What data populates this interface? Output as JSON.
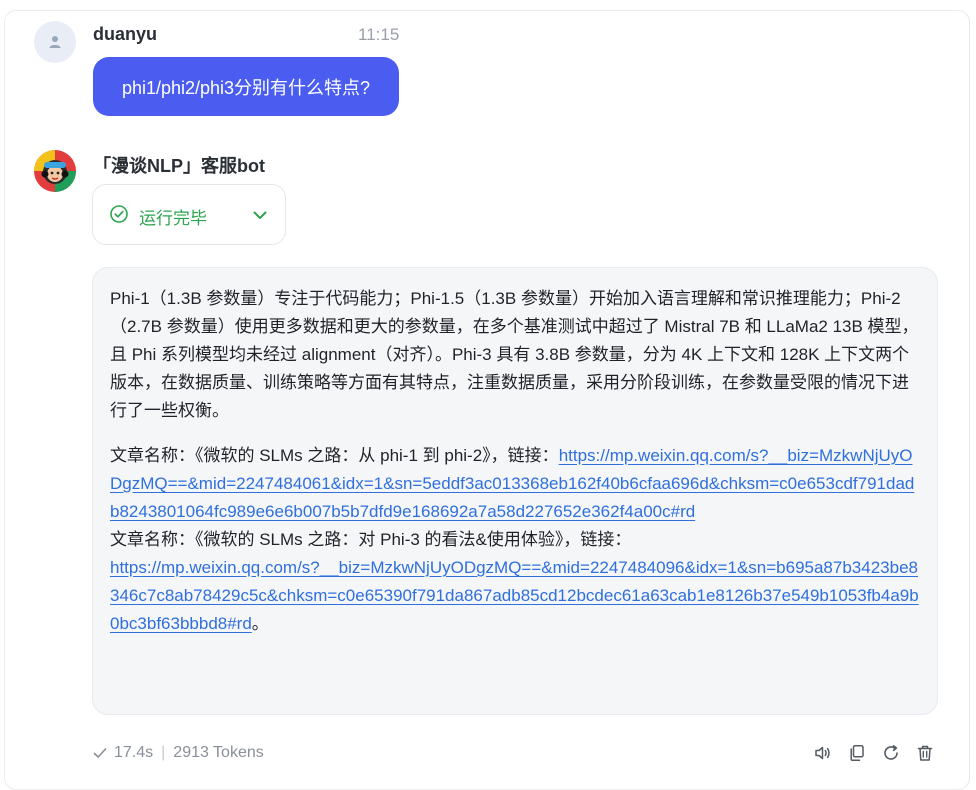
{
  "user_message": {
    "author": "duanyu",
    "time": "11:15",
    "text": "phi1/phi2/phi3分别有什么特点?"
  },
  "bot_message": {
    "author": "「漫谈NLP」客服bot",
    "status": "运行完毕",
    "paragraph": "Phi-1（1.3B 参数量）专注于代码能力；Phi-1.5（1.3B 参数量）开始加入语言理解和常识推理能力；Phi-2（2.7B 参数量）使用更多数据和更大的参数量，在多个基准测试中超过了 Mistral 7B 和 LLaMa2 13B 模型，且 Phi 系列模型均未经过 alignment（对齐）。Phi-3 具有 3.8B 参数量，分为 4K 上下文和 128K 上下文两个版本，在数据质量、训练策略等方面有其特点，注重数据质量，采用分阶段训练，在参数量受限的情况下进行了一些权衡。",
    "ref1_prefix": "文章名称：《微软的 SLMs 之路：从 phi-1 到 phi-2》，链接：",
    "ref1_link": "https://mp.weixin.qq.com/s?__biz=MzkwNjUyODgzMQ==&mid=2247484061&idx=1&sn=5eddf3ac013368eb162f40b6cfaa696d&chksm=c0e653cdf791dadb8243801064fc989e6e6b007b5b7dfd9e168692a7a58d227652e362f4a00c#rd",
    "ref2_prefix": "文章名称：《微软的 SLMs 之路：对 Phi-3 的看法&使用体验》，链接：",
    "ref2_link": "https://mp.weixin.qq.com/s?__biz=MzkwNjUyODgzMQ==&mid=2247484096&idx=1&sn=b695a87b3423be8346c7c8ab78429c5c&chksm=c0e65390f791da867adb85cd12bcdec61a63cab1e8126b37e549b1053fb4a9b0bc3bf63bbbd8#rd",
    "ref2_suffix": "。"
  },
  "footer": {
    "duration": "17.4s",
    "tokens": "2913 Tokens"
  },
  "colors": {
    "accent": "#4a5df0",
    "link": "#2f6fde",
    "success": "#2da44e"
  },
  "icons": {
    "user_avatar": "person-icon",
    "status": "check-circle-icon",
    "expand": "chevron-down-icon",
    "tools": [
      "speaker-icon",
      "copy-icon",
      "refresh-icon",
      "trash-icon"
    ]
  }
}
